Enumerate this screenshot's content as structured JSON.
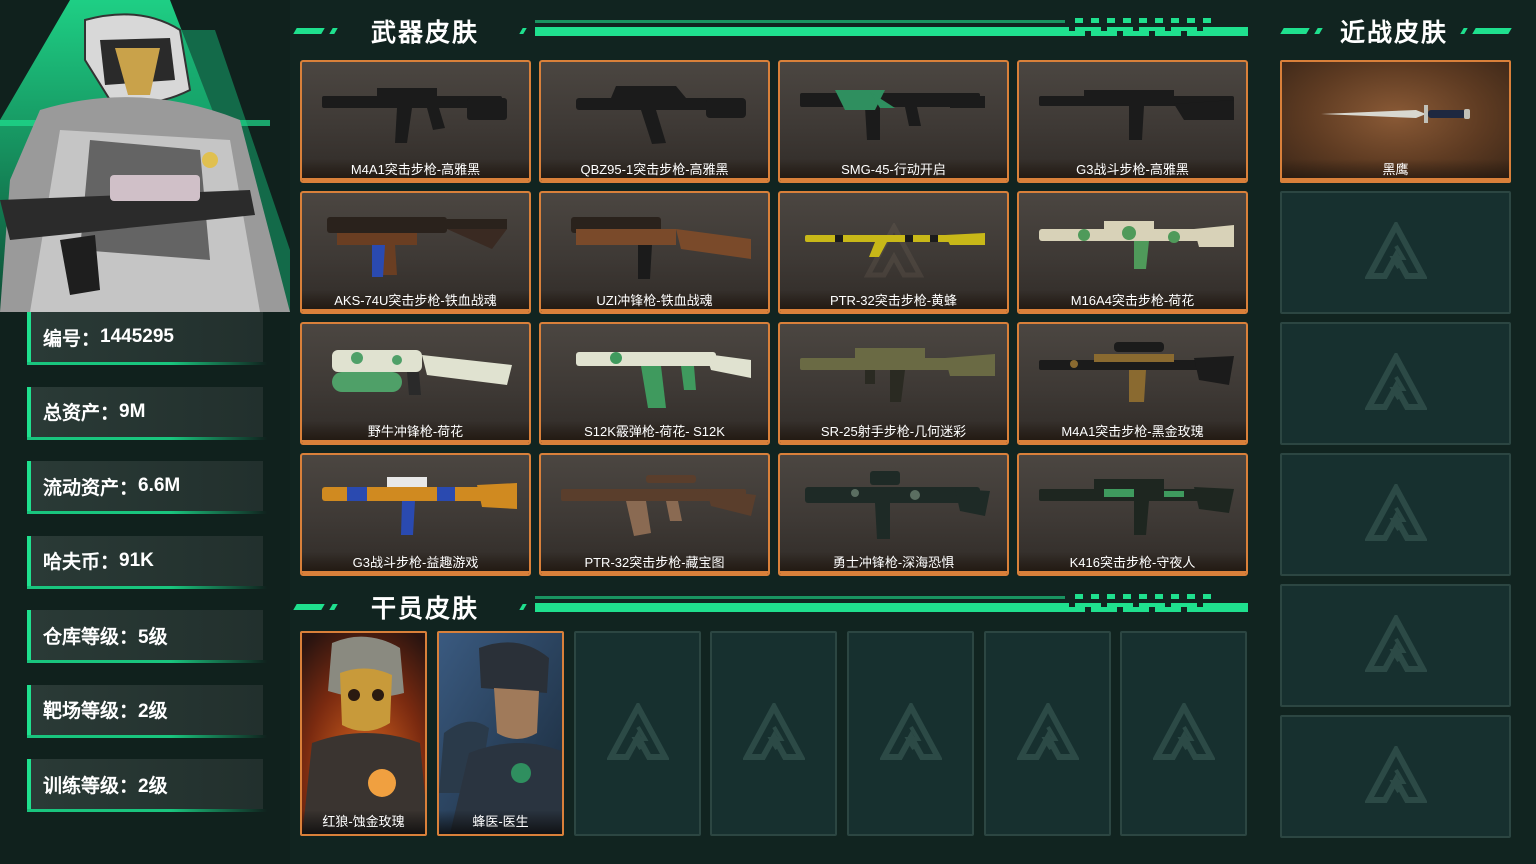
{
  "profile": {
    "stats": [
      {
        "label": "编号：",
        "value": "1445295"
      },
      {
        "label": "总资产：",
        "value": "9M"
      },
      {
        "label": "流动资产：",
        "value": "6.6M"
      },
      {
        "label": "哈夫币：",
        "value": "91K"
      },
      {
        "label": "仓库等级：",
        "value": "5级"
      },
      {
        "label": "靶场等级：",
        "value": "2级"
      },
      {
        "label": "训练等级：",
        "value": "2级"
      }
    ]
  },
  "sections": {
    "weapons_title": "武器皮肤",
    "melee_title": "近战皮肤",
    "operators_title": "干员皮肤"
  },
  "weapons": [
    {
      "name": "M4A1突击步枪-高雅黑",
      "icon": "rifle-icon",
      "color": "#1c1c1c"
    },
    {
      "name": "QBZ95-1突击步枪-高雅黑",
      "icon": "bullpup-rifle-icon",
      "color": "#1c1c1c"
    },
    {
      "name": "SMG-45-行动开启",
      "icon": "smg-icon",
      "color": "#2f8f5f"
    },
    {
      "name": "G3战斗步枪-高雅黑",
      "icon": "battle-rifle-icon",
      "color": "#1c1c1c"
    },
    {
      "name": "AKS-74U突击步枪-铁血战魂",
      "icon": "carbine-icon",
      "color": "#5a3a24"
    },
    {
      "name": "UZI冲锋枪-铁血战魂",
      "icon": "uzi-icon",
      "color": "#7a4a2a"
    },
    {
      "name": "PTR-32突击步枪-黄蜂",
      "icon": "rifle-icon",
      "color": "#c8b818"
    },
    {
      "name": "M16A4突击步枪-荷花",
      "icon": "rifle-icon",
      "color": "#8fb87a"
    },
    {
      "name": "野牛冲锋枪-荷花",
      "icon": "smg-icon",
      "color": "#5fb070"
    },
    {
      "name": "S12K霰弹枪-荷花- S12K",
      "icon": "shotgun-icon",
      "color": "#4fa068"
    },
    {
      "name": "SR-25射手步枪-几何迷彩",
      "icon": "marksman-rifle-icon",
      "color": "#6a6a44"
    },
    {
      "name": "M4A1突击步枪-黑金玫瑰",
      "icon": "rifle-icon",
      "color": "#8a6a30"
    },
    {
      "name": "G3战斗步枪-益趣游戏",
      "icon": "battle-rifle-icon",
      "color": "#d08a20"
    },
    {
      "name": "PTR-32突击步枪-藏宝图",
      "icon": "rifle-icon",
      "color": "#6a4a32"
    },
    {
      "name": "勇士冲锋枪-深海恐惧",
      "icon": "smg-icon",
      "color": "#2a3a34"
    },
    {
      "name": "K416突击步枪-守夜人",
      "icon": "rifle-icon",
      "color": "#2a3a30"
    }
  ],
  "melee": [
    {
      "name": "黑鹰",
      "icon": "knife-icon"
    }
  ],
  "melee_empty_slots": 5,
  "operators": [
    {
      "name": "红狼-蚀金玫瑰",
      "icon": "operator-portrait-gold-mask"
    },
    {
      "name": "蜂医-医生",
      "icon": "operator-portrait-medic"
    }
  ],
  "operator_empty_slots": 5,
  "colors": {
    "accent": "#1fe08e",
    "card_border": "#d9803a",
    "background": "#112420",
    "empty_slot": "#17302f"
  }
}
